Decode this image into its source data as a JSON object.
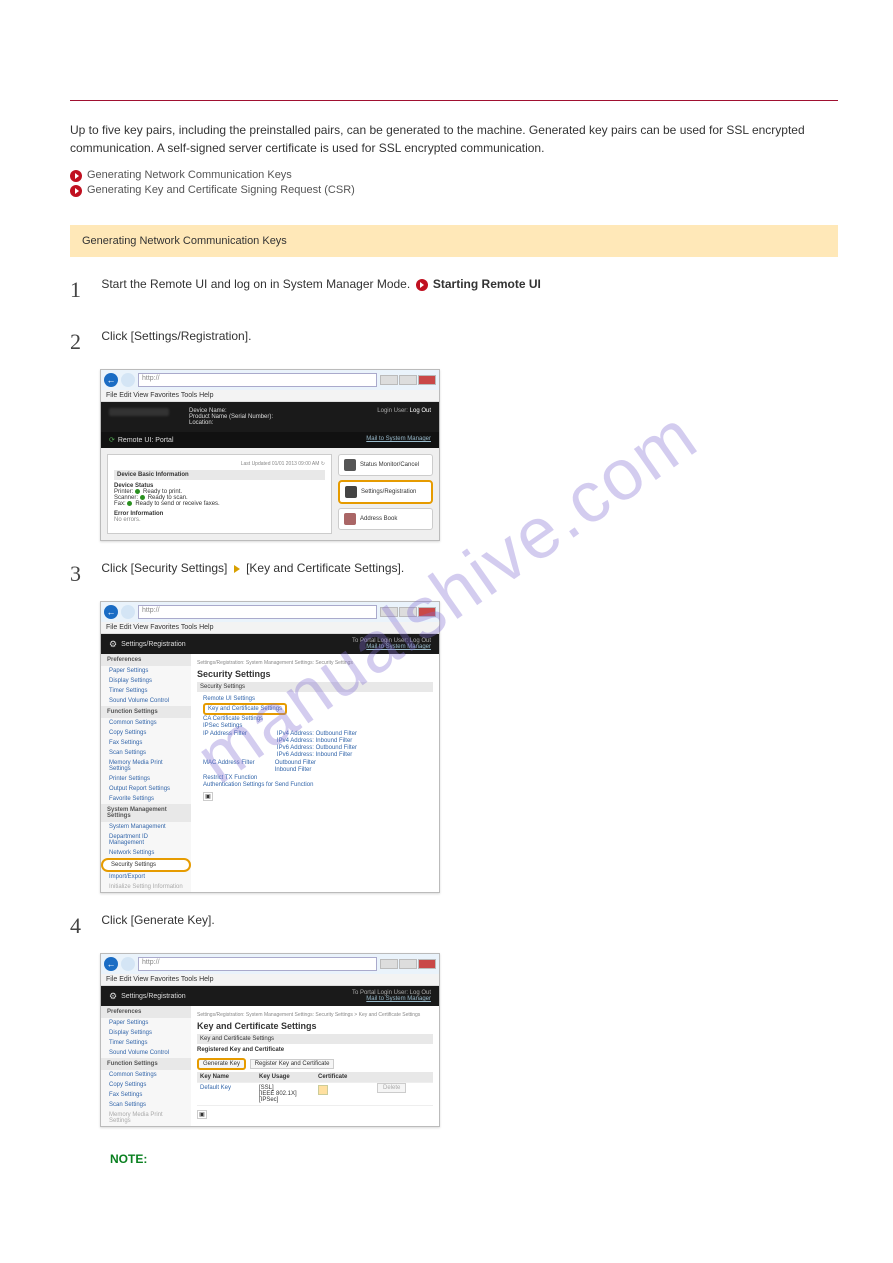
{
  "watermark": "manualshive.com",
  "intro": "Up to five key pairs, including the preinstalled pairs, can be generated to the machine. Generated key pairs can be used for SSL encrypted communication. A self-signed server certificate is used for SSL encrypted communication.",
  "bullets": [
    "Generating Network Communication Keys",
    "Generating Key and Certificate Signing Request (CSR)"
  ],
  "noteBanner": "Generating Network Communication Keys",
  "step1": {
    "num": "1",
    "pre": "Start the Remote UI and log on in System Manager Mode.",
    "link": "Starting Remote UI"
  },
  "step2": {
    "num": "2",
    "text": "Click [Settings/Registration]."
  },
  "step3": {
    "num": "3",
    "pre": "Click [Security Settings]",
    "post": "[Key and Certificate Settings]."
  },
  "step4": {
    "num": "4",
    "text": "Click [Generate Key]."
  },
  "noteLabel": "NOTE:",
  "shot1": {
    "menubar": "File  Edit  View  Favorites  Tools  Help",
    "deviceName": "Device Name:",
    "productName": "Product Name (Serial Number):",
    "location": "Location:",
    "loginUser": "Login User:",
    "logout": "Log Out",
    "portalTitle": "Remote UI: Portal",
    "mailLink": "Mail to System Manager",
    "updated": "Last Updated 01/01 2013 09:00 AM",
    "basicInfo": "Device Basic Information",
    "deviceStatus": "Device Status",
    "printer": "Printer:",
    "printerStatus": "Ready to print.",
    "scanner": "Scanner:",
    "scannerStatus": "Ready to scan.",
    "fax": "Fax:",
    "faxStatus": "Ready to send or receive faxes.",
    "errorInfo": "Error Information",
    "noErrors": "No errors.",
    "rbtn1": "Status Monitor/Cancel",
    "rbtn2": "Settings/Registration",
    "rbtn3": "Address Book"
  },
  "shot2": {
    "menubar": "File  Edit  View  Favorites  Tools  Help",
    "topright": "To Portal    Login User:    Log Out",
    "mailLink": "Mail to System Manager",
    "title": "Settings/Registration",
    "breadcrumb": "Settings/Registration: System Management Settings: Security Settings",
    "pageTitle": "Security Settings",
    "sectionSub": "Security Settings",
    "remoteUI": "Remote UI Settings",
    "keyCert": "Key and Certificate Settings",
    "caCert": "CA Certificate Settings",
    "ipsec": "IPSec Settings",
    "ipfilter": "IP Address Filter",
    "ip1": "IPv4 Address: Outbound Filter",
    "ip2": "IPv4 Address: Inbound Filter",
    "ip3": "IPv6 Address: Outbound Filter",
    "ip4": "IPv6 Address: Inbound Filter",
    "ip5": "Outbound Filter",
    "ip6": "Inbound Filter",
    "macfilter": "MAC Address Filter",
    "restrict": "Restrict TX Function",
    "auth": "Authentication Settings for Send Function",
    "side": {
      "preferences": "Preferences",
      "paper": "Paper Settings",
      "display": "Display Settings",
      "timer": "Timer Settings",
      "sound": "Sound Volume Control",
      "func": "Function Settings",
      "common": "Common Settings",
      "copy": "Copy Settings",
      "faxset": "Fax Settings",
      "scan": "Scan Settings",
      "memory": "Memory Media Print Settings",
      "printer": "Printer Settings",
      "output": "Output Report Settings",
      "favorite": "Favorite Settings",
      "sysmgmt": "System Management Settings",
      "sysmgmt2": "System Management",
      "dept": "Department ID Management",
      "network": "Network Settings",
      "security": "Security Settings",
      "import": "Import/Export",
      "init": "Initialize Setting Information"
    }
  },
  "shot3": {
    "menubar": "File  Edit  View  Favorites  Tools  Help",
    "topright": "To Portal    Login User:    Log Out",
    "mailLink": "Mail to System Manager",
    "title": "Settings/Registration",
    "breadcrumb": "Settings/Registration: System Management Settings: Security Settings > Key and Certificate Settings",
    "pageTitle": "Key and Certificate Settings",
    "sectionSub": "Key and Certificate Settings",
    "regKey": "Registered Key and Certificate",
    "genKey": "Generate Key",
    "regBtn": "Register Key and Certificate",
    "col1": "Key Name",
    "col2": "Key Usage",
    "col3": "Certificate",
    "row1name": "Default Key",
    "row1usage1": "[SSL]",
    "row1usage2": "[IEEE 802.1X]",
    "row1usage3": "[IPSec]",
    "deleteBtn": "Delete",
    "side": {
      "preferences": "Preferences",
      "paper": "Paper Settings",
      "display": "Display Settings",
      "timer": "Timer Settings",
      "sound": "Sound Volume Control",
      "func": "Function Settings",
      "common": "Common Settings",
      "copy": "Copy Settings",
      "faxset": "Fax Settings",
      "scan": "Scan Settings",
      "memory": "Memory Media Print Settings"
    }
  }
}
